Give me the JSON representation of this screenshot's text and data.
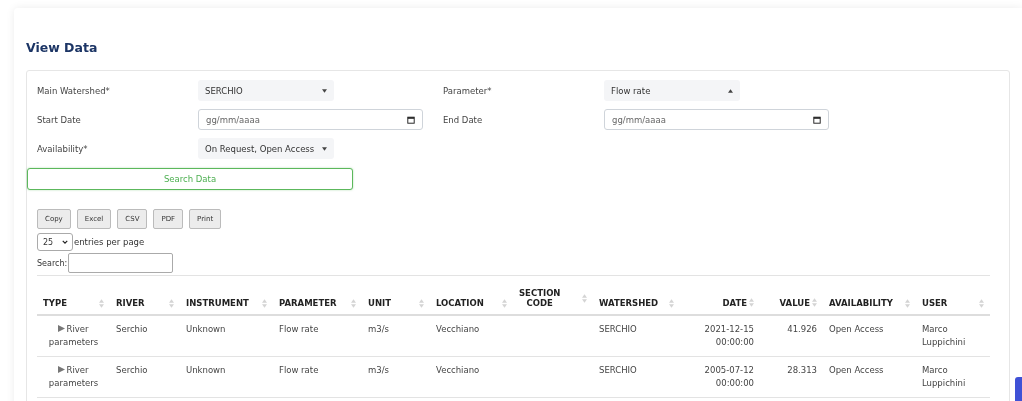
{
  "title": "View Data",
  "filters": [
    {
      "label": "Main Watershed*",
      "kind": "select",
      "value": "SERCHIO",
      "open": false
    },
    {
      "label": "Parameter*",
      "kind": "select",
      "value": "Flow rate",
      "open": true
    },
    {
      "label": "Start Date",
      "kind": "date",
      "placeholder": "gg/mm/aaaa"
    },
    {
      "label": "End Date",
      "kind": "date",
      "placeholder": "gg/mm/aaaa"
    },
    {
      "label": "Availability*",
      "kind": "select",
      "value": "On Request, Open Access",
      "open": false
    }
  ],
  "search_button": "Search Data",
  "export_buttons": [
    "Copy",
    "Excel",
    "CSV",
    "PDF",
    "Print"
  ],
  "page_size": {
    "value": "25",
    "label": "entries per page"
  },
  "search": {
    "label": "Search:"
  },
  "table": {
    "columns": [
      "TYPE",
      "RIVER",
      "INSTRUMENT",
      "PARAMETER",
      "UNIT",
      "LOCATION",
      "SECTION CODE",
      "WATERSHED",
      "DATE",
      "VALUE",
      "AVAILABILITY",
      "USER"
    ],
    "rows": [
      {
        "cells": [
          "River parameters",
          "Serchio",
          "Unknown",
          "Flow rate",
          "m3/s",
          "Vecchiano",
          "",
          "SERCHIO",
          "2021-12-15 00:00:00",
          "41.926",
          "Open Access",
          "Marco Luppichini"
        ]
      },
      {
        "cells": [
          "River parameters",
          "Serchio",
          "Unknown",
          "Flow rate",
          "m3/s",
          "Vecchiano",
          "",
          "SERCHIO",
          "2005-07-12 00:00:00",
          "28.313",
          "Open Access",
          "Marco Luppichini"
        ]
      }
    ]
  }
}
